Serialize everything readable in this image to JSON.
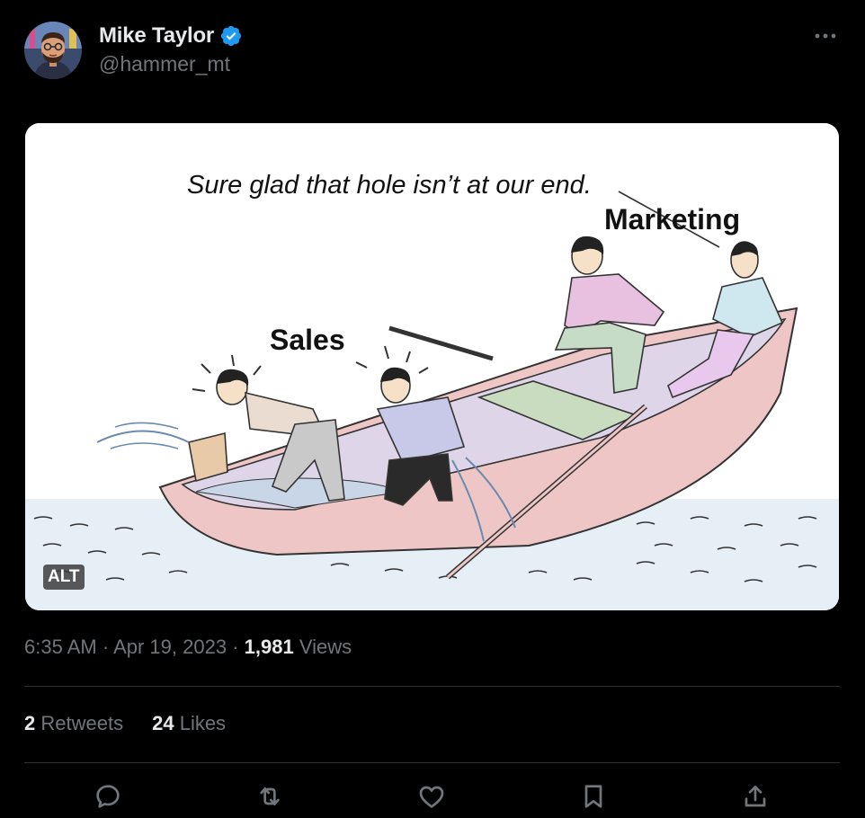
{
  "author": {
    "display_name": "Mike Taylor",
    "handle": "@hammer_mt",
    "verified": true,
    "avatar_icon": "avatar-illustration"
  },
  "header": {
    "more_icon": "more-horizontal-icon"
  },
  "media": {
    "caption": "Sure glad that hole isn’t at our end.",
    "label_sales": "Sales",
    "label_marketing": "Marketing",
    "alt_badge": "ALT"
  },
  "meta": {
    "time": "6:35 AM",
    "separator1": "·",
    "date": "Apr 19, 2023",
    "separator2": "·",
    "views_count": "1,981",
    "views_label": "Views"
  },
  "stats": {
    "retweets_count": "2",
    "retweets_label": "Retweets",
    "likes_count": "24",
    "likes_label": "Likes"
  },
  "actions": {
    "reply_icon": "reply-icon",
    "retweet_icon": "retweet-icon",
    "like_icon": "heart-icon",
    "bookmark_icon": "bookmark-icon",
    "share_icon": "share-icon"
  },
  "colors": {
    "background": "#000000",
    "text_primary": "#e7e9ea",
    "text_secondary": "#71767b",
    "verified_blue": "#1d9bf0",
    "divider": "#2f3336"
  }
}
